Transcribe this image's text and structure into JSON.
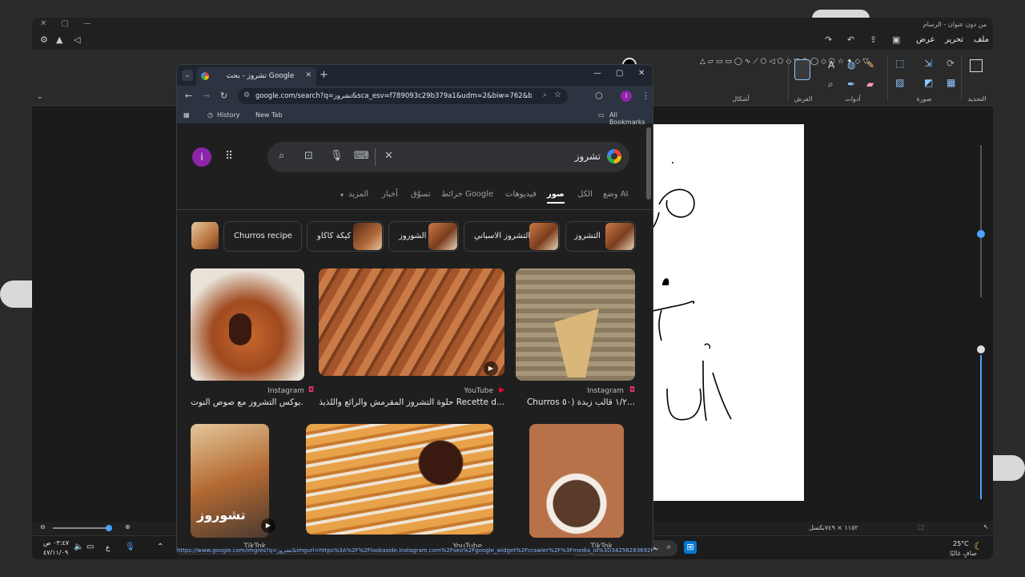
{
  "paint": {
    "title": "من دون عنوان - الرسام",
    "menus": [
      "ملف",
      "تحرير",
      "عرض"
    ],
    "groups": {
      "selection": "التحديد",
      "image": "صورة",
      "tools": "أدوات",
      "brushes": "الفرش",
      "shapes": "أشكال"
    },
    "status": {
      "size": "١١٥٢ × ٧٤٩بكسل"
    }
  },
  "chrome": {
    "tab_title": "تشروز - بحث Google",
    "url": "google.com/search?q=تشروز&sca_esv=f789093c29b379a1&udm=2&biw=762&bih=690&sx...",
    "bookmarks": {
      "history": "History",
      "new_tab": "New Tab",
      "all": "All Bookmarks"
    },
    "search_query": "تشروز",
    "avatar_letter": "i",
    "tabs": [
      "وضع AI",
      "الكل",
      "صور",
      "فيديوهات",
      "خرائط Google",
      "تسوّق",
      "أخبار",
      "المزيد"
    ],
    "chips": [
      "التشروز",
      "التشروز الاسباني",
      "الشوروز",
      "كيكة كاكاو",
      "Churros recipe"
    ],
    "results_row1": [
      {
        "source": "Instagram",
        "caption": "بوكس التشروز مع صوص النوت..."
      },
      {
        "source": "YouTube",
        "caption": "حلوة التشروز المقرمش والرائع واللذيذ Recette d..."
      },
      {
        "source": "Instagram",
        "caption": "Churros ١/٢ قالب زبدة (٥٠..."
      }
    ],
    "results_row2": [
      {
        "source": "TikTok",
        "overlay": "تشوروز"
      },
      {
        "source": "YouTube"
      },
      {
        "source": "TikTok"
      }
    ],
    "status_url": "https://www.google.com/imgres?q=تشروز&imgurl=https%3A%2F%2Flookaside.instagram.com%2Fseo%2Fgoogle_widget%2Fcrawler%2F%3Fmedia_id%3D3425628369262..."
  },
  "taskbar": {
    "search": "بحث",
    "time": "٠٣:٤٧ ص",
    "date": "٤٧/١١/٠٩",
    "weather_temp": "25°C",
    "weather_desc": "صافٍ غالبًا",
    "lang": "ع"
  }
}
